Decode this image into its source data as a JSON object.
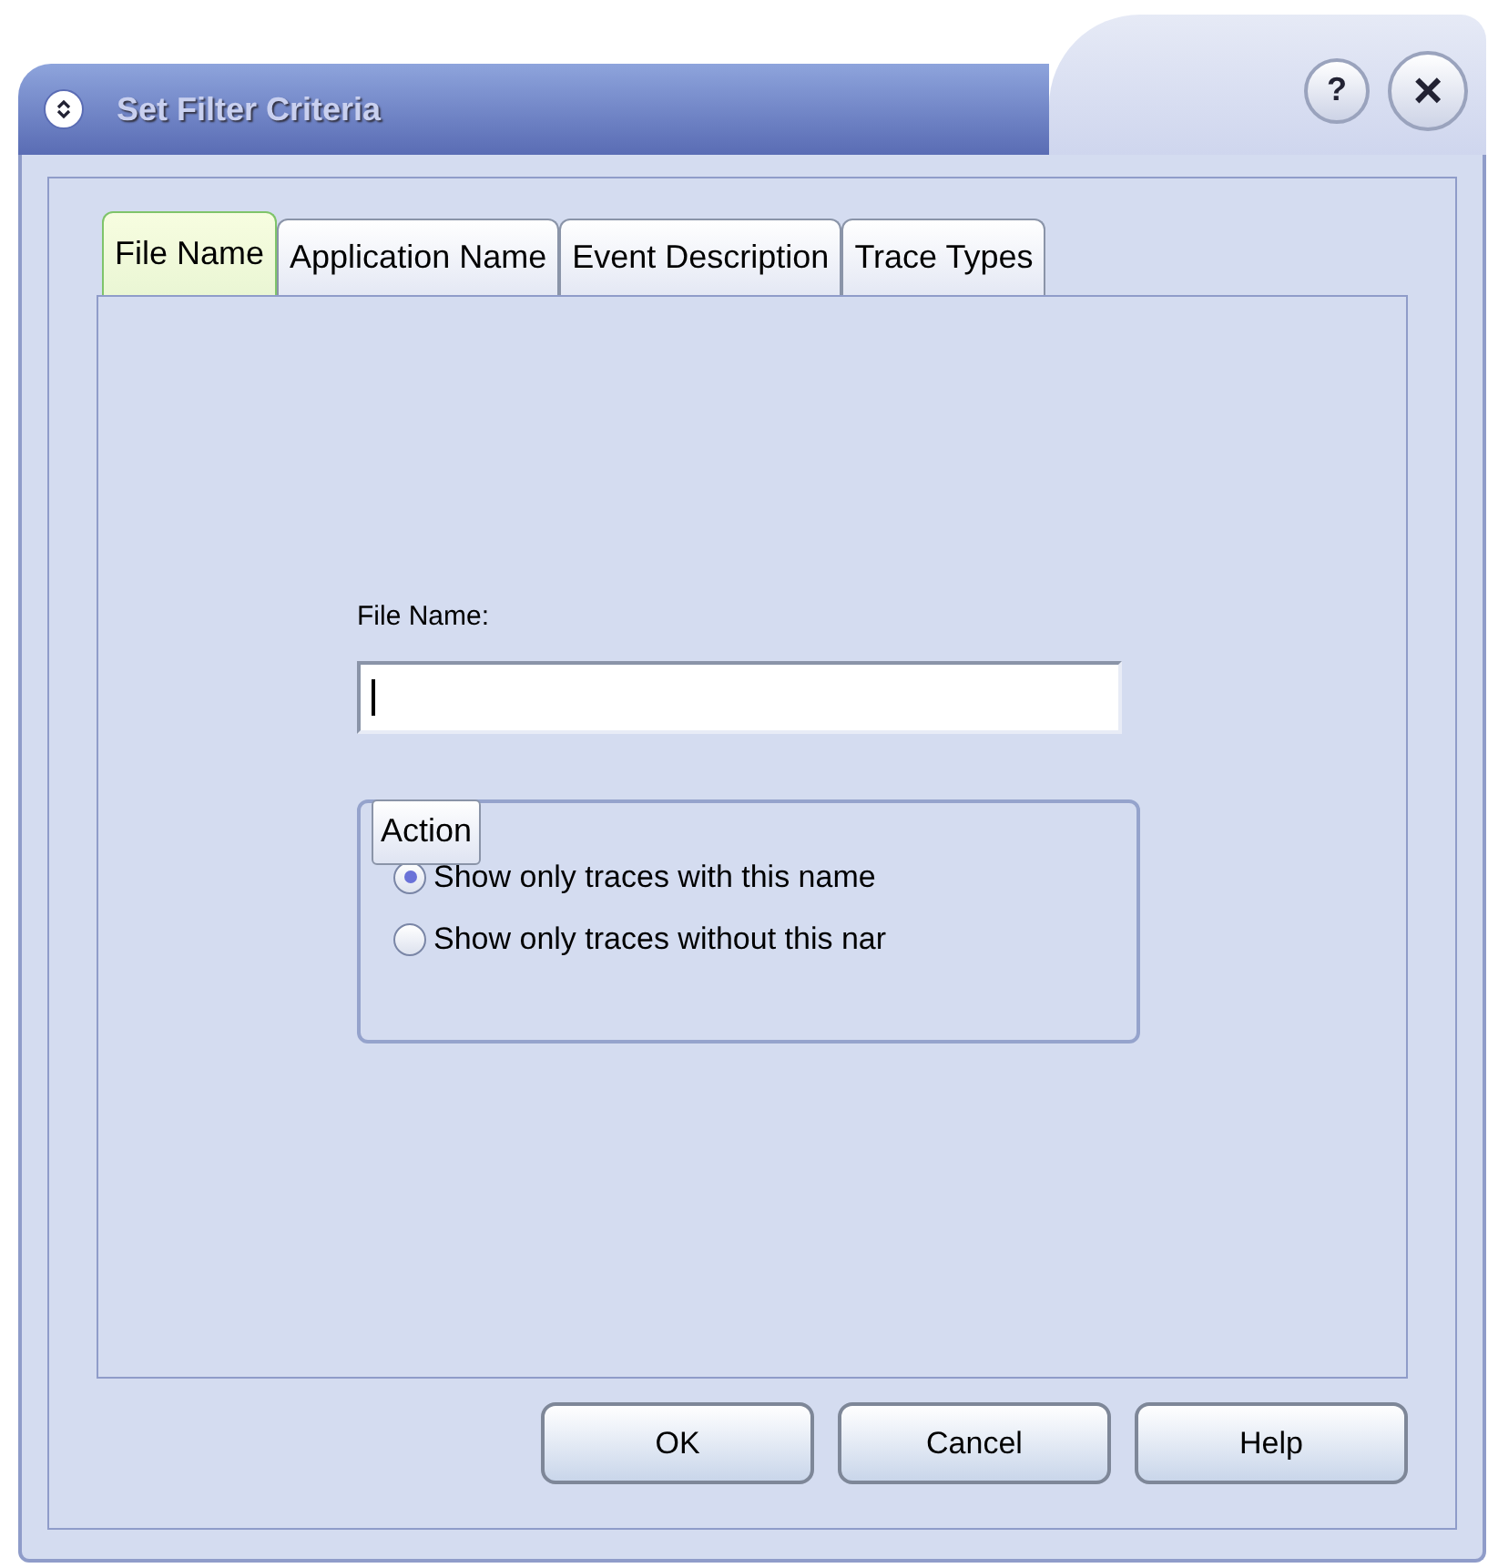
{
  "window": {
    "title": "Set Filter Criteria",
    "help_button": "?",
    "close_button": "×"
  },
  "tabs": [
    {
      "label": "File Name",
      "selected": true
    },
    {
      "label": "Application Name",
      "selected": false
    },
    {
      "label": "Event Description",
      "selected": false
    },
    {
      "label": "Trace Types",
      "selected": false
    }
  ],
  "file_name": {
    "label": "File Name:"
  },
  "action": {
    "title": "Action",
    "options": [
      {
        "label": "Show only traces with this name",
        "selected": true
      },
      {
        "label": "Show only traces without this nar",
        "selected": false
      }
    ]
  },
  "buttons": [
    "OK",
    "Cancel",
    "Help"
  ]
}
